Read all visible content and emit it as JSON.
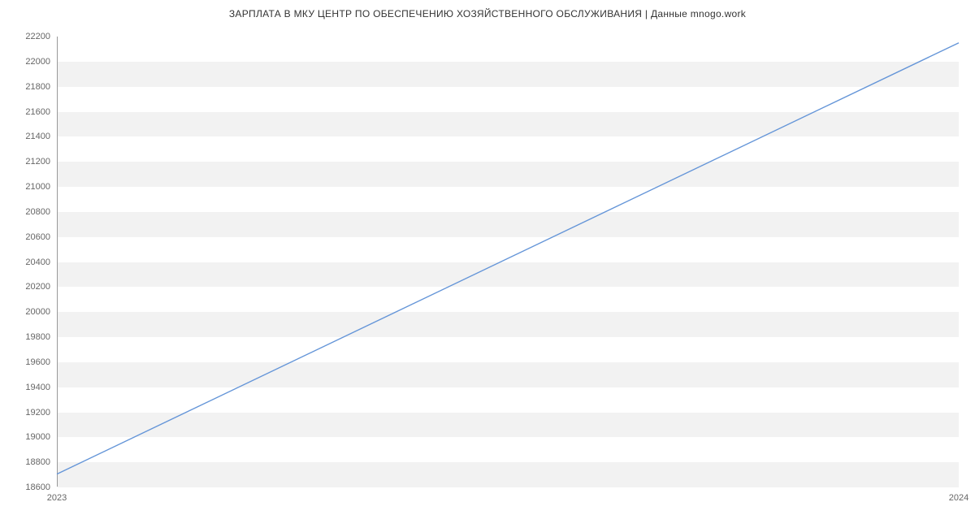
{
  "chart_data": {
    "type": "line",
    "title": "ЗАРПЛАТА В МКУ ЦЕНТР ПО ОБЕСПЕЧЕНИЮ ХОЗЯЙСТВЕННОГО ОБСЛУЖИВАНИЯ | Данные mnogo.work",
    "x": [
      "2023",
      "2024"
    ],
    "values": [
      18700,
      22150
    ],
    "xlabel": "",
    "ylabel": "",
    "ylim": [
      18600,
      22200
    ],
    "y_ticks": [
      18600,
      18800,
      19000,
      19200,
      19400,
      19600,
      19800,
      20000,
      20200,
      20400,
      20600,
      20800,
      21000,
      21200,
      21400,
      21600,
      21800,
      22000,
      22200
    ],
    "x_ticks": [
      "2023",
      "2024"
    ],
    "colors": {
      "line": "#6495d8",
      "band": "#f2f2f2"
    }
  }
}
